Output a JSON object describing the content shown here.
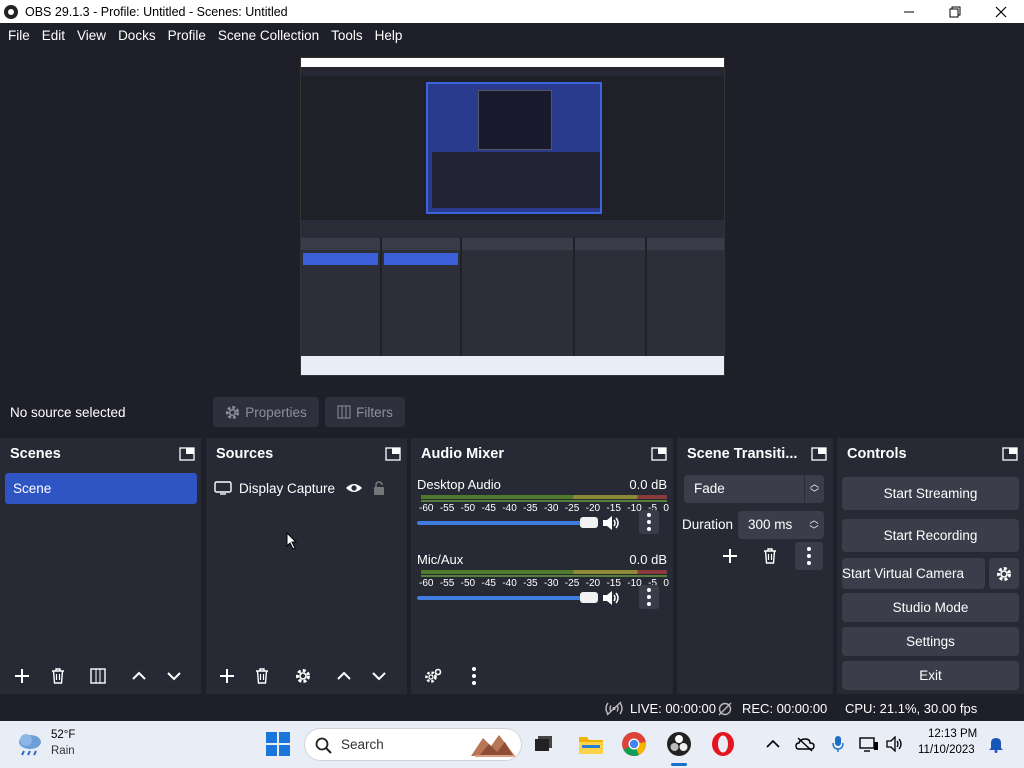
{
  "window": {
    "title": "OBS 29.1.3 - Profile: Untitled - Scenes: Untitled",
    "minimize": "—",
    "maximize": "❐",
    "close": "✕"
  },
  "menubar": [
    "File",
    "Edit",
    "View",
    "Docks",
    "Profile",
    "Scene Collection",
    "Tools",
    "Help"
  ],
  "source_toolbar": {
    "status": "No source selected",
    "properties": "Properties",
    "filters": "Filters"
  },
  "scenes": {
    "title": "Scenes",
    "items": [
      "Scene"
    ]
  },
  "sources": {
    "title": "Sources",
    "items": [
      {
        "label": "Display Capture",
        "visible": true,
        "locked": false
      }
    ]
  },
  "mixer": {
    "title": "Audio Mixer",
    "channels": [
      {
        "name": "Desktop Audio",
        "level": "0.0 dB",
        "volume_percent": 100
      },
      {
        "name": "Mic/Aux",
        "level": "0.0 dB",
        "volume_percent": 100
      }
    ],
    "scale": [
      "-60",
      "-55",
      "-50",
      "-45",
      "-40",
      "-35",
      "-30",
      "-25",
      "-20",
      "-15",
      "-10",
      "-5",
      "0"
    ]
  },
  "transitions": {
    "title": "Scene Transiti...",
    "selected": "Fade",
    "duration_label": "Duration",
    "duration_value": "300 ms"
  },
  "controls": {
    "title": "Controls",
    "start_streaming": "Start Streaming",
    "start_recording": "Start Recording",
    "start_virtual_camera": "Start Virtual Camera",
    "studio_mode": "Studio Mode",
    "settings": "Settings",
    "exit": "Exit"
  },
  "statusbar": {
    "live": "LIVE: 00:00:00",
    "rec": "REC: 00:00:00",
    "cpu": "CPU: 21.1%, 30.00 fps"
  },
  "taskbar": {
    "weather_temp": "52°F",
    "weather_cond": "Rain",
    "search_label": "Search",
    "time": "12:13 PM",
    "date": "11/10/2023"
  },
  "colors": {
    "window_bg": "#1e1f29",
    "dock_bg": "#272935",
    "accent": "#2f55c4",
    "button": "#3b3d4a",
    "slider": "#3f7ee0"
  }
}
